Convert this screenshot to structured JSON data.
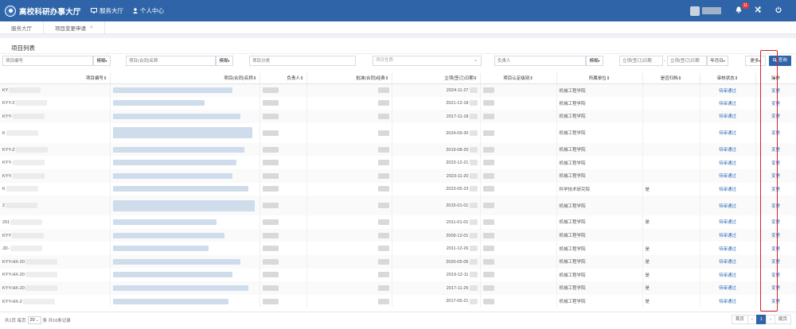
{
  "app": {
    "logo_text": "高校科研办事大厅",
    "nav": [
      {
        "label": "服务大厅",
        "icon": "monitor-icon"
      },
      {
        "label": "个人中心",
        "icon": "user-icon"
      }
    ],
    "notification_count": "11"
  },
  "tabs": [
    {
      "label": "服务大厅"
    },
    {
      "label": "项目变更申请"
    }
  ],
  "panel_title": "项目列表",
  "search": {
    "project_no_placeholder": "项目编号",
    "project_name_placeholder": "项目(合同)名称",
    "category_placeholder": "项目分类",
    "nature_placeholder": "项目性质",
    "leader_placeholder": "负责人",
    "fuzzy_label": "模糊",
    "date_start_placeholder": "立项(签订)日期",
    "date_end_placeholder": "立项(签订)日期",
    "date_sep": "-",
    "year_month_label": "年月日",
    "more_label": "更多",
    "query_label": "查询"
  },
  "table": {
    "columns": [
      "项目编号",
      "项目(合同)名称",
      "负责人",
      "批准(合同)经费",
      "立项(签订)日期",
      "项目认定级别",
      "所属单位",
      "是否归档",
      "审核状态",
      "操作"
    ],
    "rows": [
      {
        "id": "KY",
        "date": "2024-11-27",
        "unit": "机械工程学院",
        "archived": "",
        "status": "待审通过",
        "op": "变更"
      },
      {
        "id": "KYY-2",
        "date": "2021-12-18",
        "unit": "机械工程学院",
        "archived": "",
        "status": "待审通过",
        "op": "变更"
      },
      {
        "id": "KYY-",
        "date": "2017-11-18",
        "unit": "机械工程学院",
        "archived": "",
        "status": "待审通过",
        "op": "变更"
      },
      {
        "id": "K",
        "date": "2024-09-30",
        "unit": "机械工程学院",
        "archived": "",
        "status": "待审通过",
        "op": "变更"
      },
      {
        "id": "KYY-Z",
        "date": "2019-08-20",
        "unit": "机械工程学院",
        "archived": "",
        "status": "待审通过",
        "op": "变更"
      },
      {
        "id": "KYY-",
        "date": "2023-12-21",
        "unit": "机械工程学院",
        "archived": "",
        "status": "待审通过",
        "op": "变更"
      },
      {
        "id": "KYY-",
        "date": "2023-11-20",
        "unit": "机械工程学院",
        "archived": "",
        "status": "待审通过",
        "op": "变更"
      },
      {
        "id": "K",
        "date": "2023-05-23",
        "unit": "科学技术研究院",
        "archived": "是",
        "status": "待审通过",
        "op": "变更"
      },
      {
        "id": "2",
        "date": "2015-01-01",
        "unit": "机械工程学院",
        "archived": "",
        "status": "待审通过",
        "op": "变更"
      },
      {
        "id": "201",
        "date": "2011-01-01",
        "unit": "机械工程学院",
        "archived": "是",
        "status": "待审通过",
        "op": "变更"
      },
      {
        "id": "KYY",
        "date": "2009-12-01",
        "unit": "机械工程学院",
        "archived": "",
        "status": "待审通过",
        "op": "变更"
      },
      {
        "id": "JD-",
        "date": "2011-12-26",
        "unit": "机械工程学院",
        "archived": "是",
        "status": "待审通过",
        "op": "变更"
      },
      {
        "id": "KYY-HX-20",
        "date": "2020-05-05",
        "unit": "机械工程学院",
        "archived": "是",
        "status": "待审通过",
        "op": "变更"
      },
      {
        "id": "KYY-HX-20",
        "date": "2019-12-11",
        "unit": "机械工程学院",
        "archived": "是",
        "status": "待审通过",
        "op": "变更"
      },
      {
        "id": "KYY-HX-20",
        "date": "2017-11-25",
        "unit": "机械工程学院",
        "archived": "是",
        "status": "待审通过",
        "op": "变更"
      },
      {
        "id": "KYY-HX-2",
        "date": "2017-05-21",
        "unit": "机械工程学院",
        "archived": "是",
        "status": "待审通过",
        "op": "变更"
      }
    ]
  },
  "footer": {
    "info_prefix": "共1页 每页",
    "page_size": "20",
    "info_suffix": "条 共16条记录",
    "first": "首页",
    "prev": "‹",
    "current": "1",
    "next": "›",
    "last": "尾页"
  }
}
